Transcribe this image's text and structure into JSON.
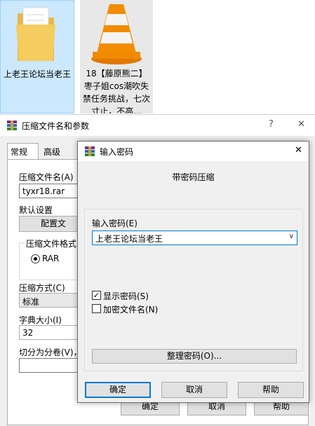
{
  "desktop": {
    "folder": {
      "label": "上老王论坛当老王"
    },
    "vlc_file": {
      "label": "18【藤原熊二】枣子姐cos潮吹失禁任务挑战，七次寸止，不高..."
    }
  },
  "archive_dialog": {
    "title": "压缩文件名和参数",
    "help_button": "?",
    "close_button": "✕",
    "tabs": [
      "常规",
      "高级"
    ],
    "archive_name_label": "压缩文件名(A)",
    "archive_name_value": "tyxr18.rar",
    "default_settings_label": "默认设置",
    "profiles_button": "配置文",
    "format_label": "压缩文件格式",
    "format_option": "RAR",
    "method_label": "压缩方式(C)",
    "method_value": "标准",
    "dictionary_label": "字典大小(I)",
    "dictionary_value": "32",
    "split_label": "切分为分卷(V)，",
    "ok_button": "确定",
    "cancel_button": "取消",
    "help_text_button": "帮助"
  },
  "password_dialog": {
    "title": "输入密码",
    "close_button": "✕",
    "heading": "带密码压缩",
    "password_label": "输入密码(E)",
    "password_value": "上老王论坛当老王",
    "show_password_label": "显示密码(S)",
    "show_password_checked": true,
    "encrypt_names_label": "加密文件名(N)",
    "encrypt_names_checked": false,
    "organize_button": "整理密码(O)...",
    "ok_button": "确定",
    "cancel_button": "取消",
    "help_button": "帮助"
  },
  "colors": {
    "selection": "#cce8ff",
    "accent": "#0078d7",
    "vlc_orange": "#f08a00"
  }
}
